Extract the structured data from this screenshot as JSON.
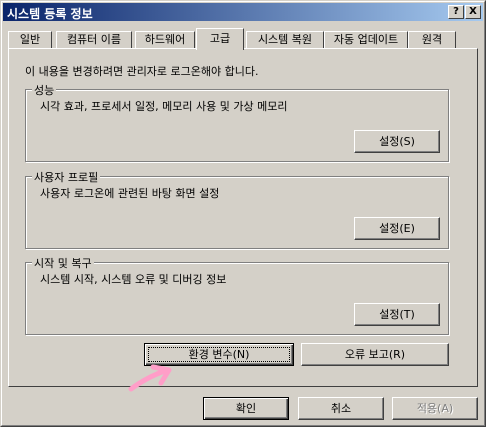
{
  "window": {
    "title": "시스템 등록 정보",
    "help": "?",
    "close": "X"
  },
  "tabs": [
    {
      "label": "일반"
    },
    {
      "label": "컴퓨터 이름"
    },
    {
      "label": "하드웨어"
    },
    {
      "label": "고급"
    },
    {
      "label": "시스템 복원"
    },
    {
      "label": "자동 업데이트"
    },
    {
      "label": "원격"
    }
  ],
  "active_tab": "고급",
  "notice": "이 내용을 변경하려면 관리자로 로그온해야 합니다.",
  "groups": {
    "performance": {
      "title": "성능",
      "desc": "시각 효과, 프로세서 일정, 메모리 사용 및 가상 메모리",
      "button": "설정(S)"
    },
    "user_profiles": {
      "title": "사용자 프로필",
      "desc": "사용자 로그온에 관련된 바탕 화면 설정",
      "button": "설정(E)"
    },
    "startup_recovery": {
      "title": "시작 및 복구",
      "desc": "시스템 시작, 시스템 오류 및 디버깅 정보",
      "button": "설정(T)"
    }
  },
  "buttons": {
    "env_vars": "환경 변수(N)",
    "error_report": "오류 보고(R)",
    "ok": "확인",
    "cancel": "취소",
    "apply": "적용(A)"
  },
  "colors": {
    "face": "#d4d0c8",
    "title_start": "#0a246a",
    "title_end": "#a6caf0",
    "annotation_arrow": "#ff9ec8"
  }
}
